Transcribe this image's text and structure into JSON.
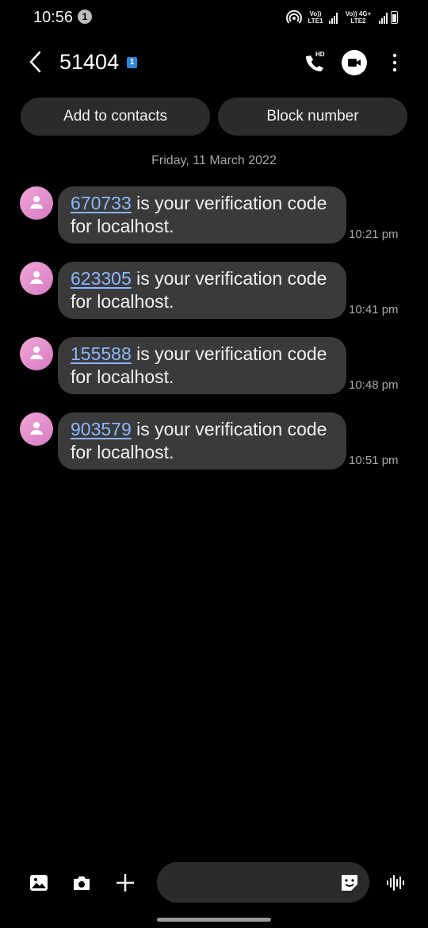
{
  "status_bar": {
    "time": "10:56",
    "notification_count": "1",
    "sim1_label": "Vo)) LTE1",
    "sim2_label": "Vo)) 4G+ LTE2",
    "icons": [
      "hotspot-icon",
      "signal-icon",
      "battery-icon"
    ]
  },
  "header": {
    "title": "51404",
    "sim_badge": "1",
    "icons": [
      "back-arrow-icon",
      "hd-call-icon",
      "video-call-icon",
      "more-icon"
    ]
  },
  "actions": {
    "add_to_contacts": "Add to contacts",
    "block_number": "Block number"
  },
  "date_header": "Friday, 11 March 2022",
  "messages": [
    {
      "code": "670733",
      "text": " is your verification code for localhost.",
      "time": "10:21 pm"
    },
    {
      "code": "623305",
      "text": " is your verification code for localhost.",
      "time": "10:41 pm"
    },
    {
      "code": "155588",
      "text": " is your verification code for localhost.",
      "time": "10:48 pm"
    },
    {
      "code": "903579",
      "text": " is your verification code for localhost.",
      "time": "10:51 pm"
    }
  ],
  "composer": {
    "icons": [
      "gallery-icon",
      "camera-icon",
      "plus-icon",
      "sticker-icon",
      "voice-icon"
    ],
    "input_value": ""
  },
  "colors": {
    "background": "#000000",
    "bubble": "#3a3a3a",
    "link": "#8bb7ff",
    "avatar": "#e79bd0"
  }
}
